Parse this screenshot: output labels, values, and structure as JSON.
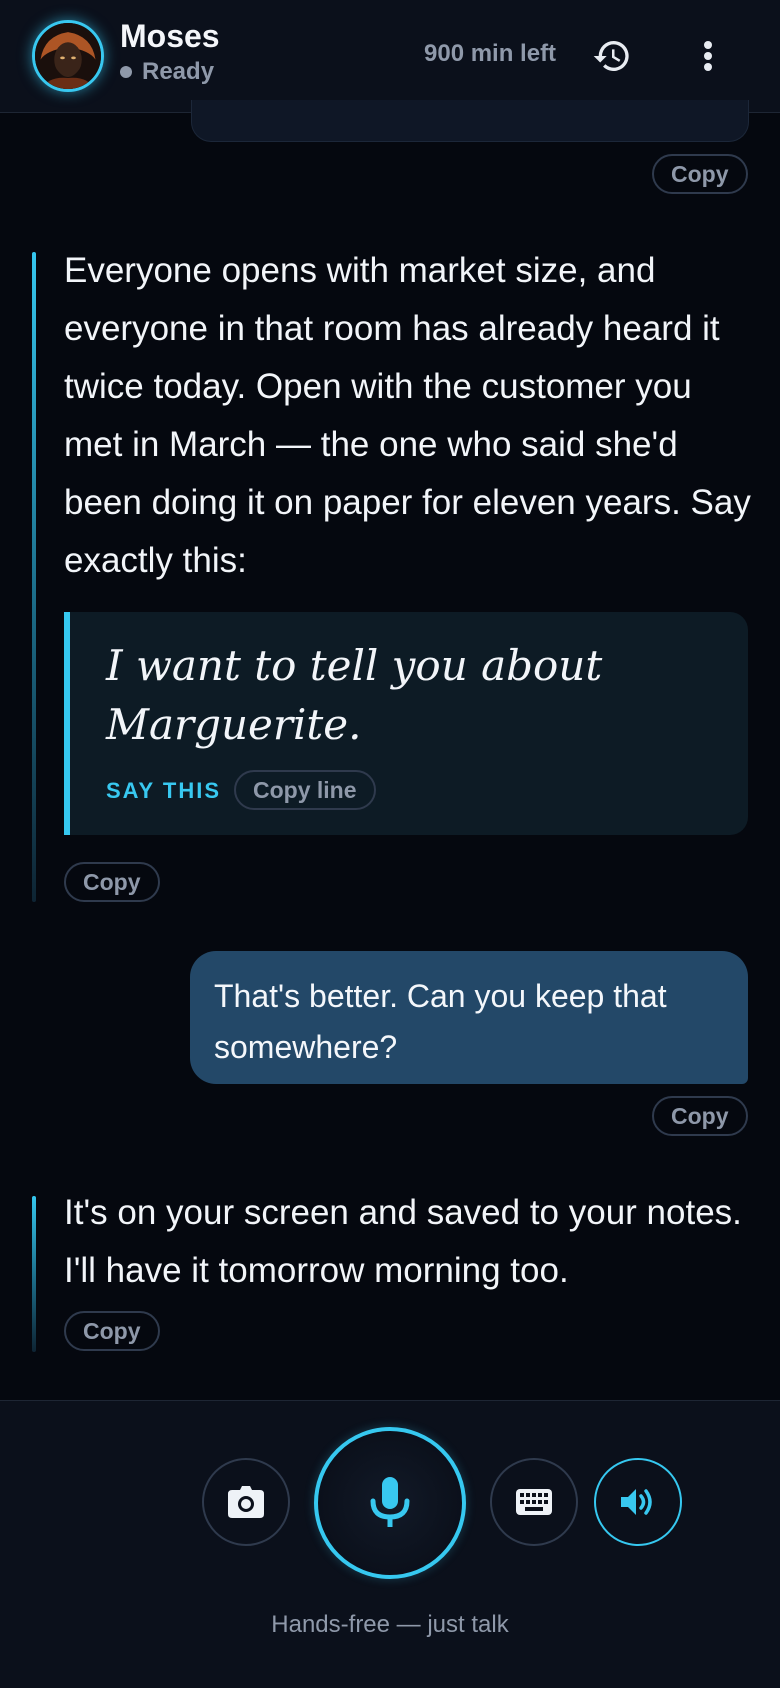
{
  "header": {
    "name": "Moses",
    "status": "Ready",
    "minutes_left": "900 min left"
  },
  "messages": {
    "copy_label": "Copy",
    "ai_1": {
      "text": "Everyone opens with market size, and everyone in that room has already heard it twice today. Open with the customer you met in March — the one who said she'd been doing it on paper for eleven years. Say exactly this:",
      "quote": "I want to tell you about Marguerite.",
      "say_this_label": "SAY THIS",
      "copy_line_label": "Copy line"
    },
    "user_1": {
      "text": "That's better. Can you keep that somewhere?"
    },
    "ai_2": {
      "text": "It's on your screen and saved to your notes. I'll have it tomorrow morning too."
    }
  },
  "controls": {
    "hint": "Hands-free — just talk"
  },
  "colors": {
    "accent": "#38c8f0",
    "background": "#05080f",
    "user_bubble": "#234868",
    "muted_text": "#8f99aa"
  },
  "icons": [
    "avatar-portrait",
    "history-icon",
    "more-vertical-icon",
    "camera-icon",
    "microphone-icon",
    "keyboard-icon",
    "speaker-icon"
  ]
}
